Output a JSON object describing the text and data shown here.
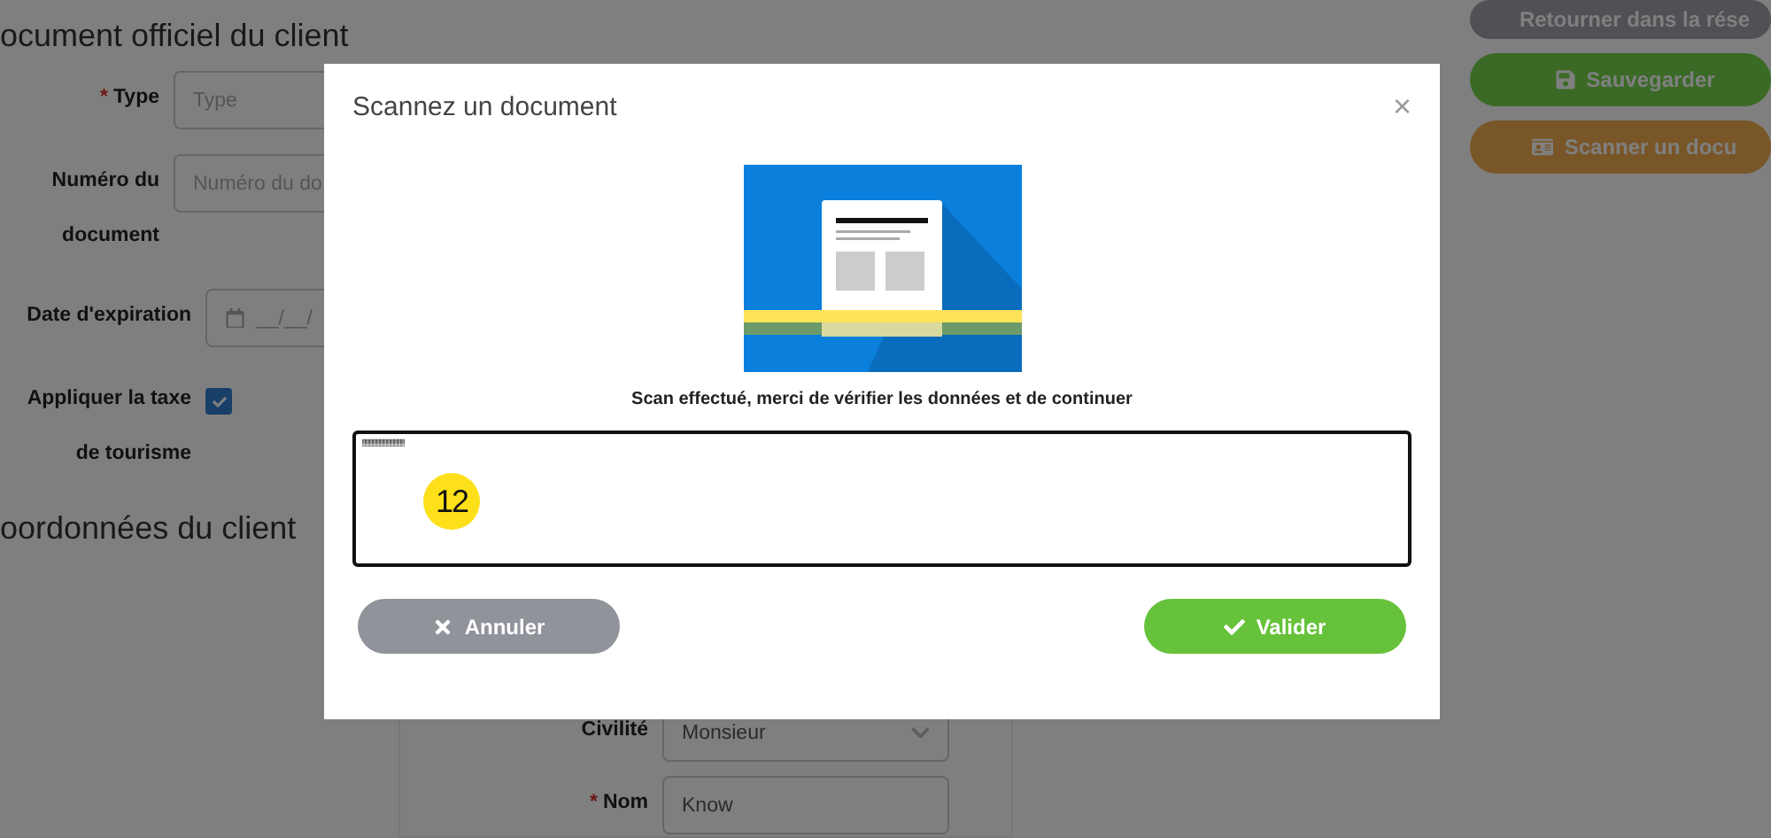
{
  "form": {
    "heading": "ocument officiel du client",
    "fields": [
      {
        "kind": "text",
        "label": "Type",
        "required_mark": "*",
        "placeholder": "Type"
      },
      {
        "kind": "text",
        "label": "Numéro du document",
        "placeholder": "Numéro du do"
      },
      {
        "kind": "date",
        "label": "Date d'expiration",
        "placeholder": "__/__/"
      },
      {
        "kind": "checkbox",
        "label": "Appliquer la taxe de tourisme",
        "checked": true
      }
    ],
    "heading_2": "oordonnées du client",
    "contact_fields": [
      {
        "kind": "select",
        "label": "Civilité",
        "value": "Monsieur"
      },
      {
        "kind": "text",
        "label": "Nom",
        "required_mark": "*",
        "value": "Know"
      }
    ]
  },
  "actions": [
    {
      "kind": "back",
      "label": "Retourner dans la rése"
    },
    {
      "kind": "save",
      "label": "Sauvegarder"
    },
    {
      "kind": "scan",
      "label": "Scanner un docu"
    }
  ],
  "modal": {
    "title": "Scannez un document",
    "close": "×",
    "message": "Scan effectué, merci de vérifier les données et de continuer",
    "scan_text": "!!!!!!!!!!!!!!!!!!!!!!!!!!!!!!!!!!!!",
    "badge": "12",
    "buttons": [
      {
        "kind": "cancel",
        "label": "Annuler"
      },
      {
        "kind": "confirm",
        "label": "Valider"
      }
    ]
  }
}
